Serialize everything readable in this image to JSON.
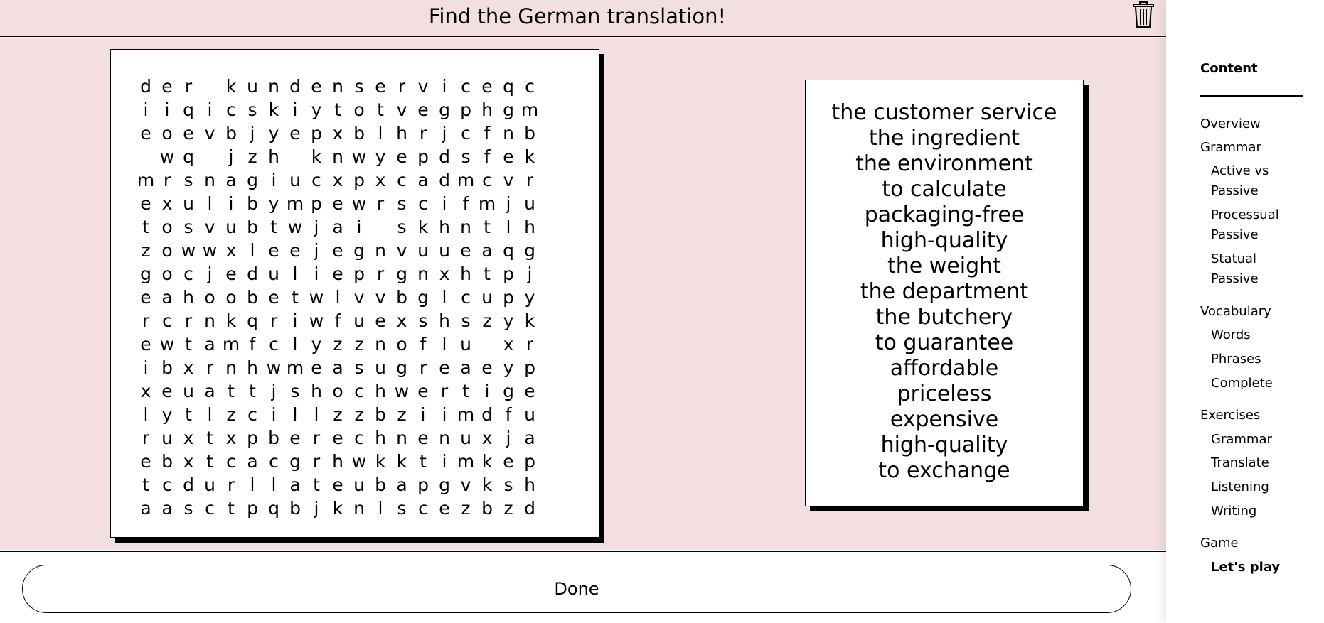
{
  "header": {
    "title": "Find the German translation!"
  },
  "grid": {
    "rows": [
      "der kundenserviceqc",
      "iiqicskiytotvegphgm",
      "eoevbjyepxblhrjcfnb",
      " wq jzh knwyepdsfek",
      "mrsnagiucxpxcadmcvr",
      "exulibympewrscifmju",
      "tosvubtwjai skhntlh",
      "zowwxleejegnvuueaqg",
      "gocjedulieprgnxhtpj",
      "eahoobetwlvvbglcupy",
      "rcrnkqriwfuexshszyk",
      "ewtamfclyzznoflu xr",
      "ibxrnhwmeasugreaeyp",
      "xeuattjshochwertige",
      "lytlzcillzzbziimdfu",
      "ruxtxpberechnenuxja",
      "ebxtcacgrhwkktimkep",
      "tcdurllateubapgvksh",
      "aasctpqbjknlscezbzd"
    ]
  },
  "words": [
    "the customer service",
    "the ingredient",
    "the environment",
    "to calculate",
    "packaging-free",
    "high-quality",
    "the weight",
    "the department",
    "the butchery",
    "to guarantee",
    "affordable",
    "priceless",
    "expensive",
    "high-quality",
    "to exchange"
  ],
  "footer": {
    "done_label": "Done"
  },
  "sidebar": {
    "title": "Content",
    "overview": "Overview",
    "grammar": "Grammar",
    "active_vs_passive_1": "Active vs",
    "active_vs_passive_2": "Passive",
    "processual_1": "Processual",
    "processual_2": "Passive",
    "statual_1": "Statual",
    "statual_2": "Passive",
    "vocabulary": "Vocabulary",
    "words": "Words",
    "phrases": "Phrases",
    "complete": "Complete",
    "exercises": "Exercises",
    "ex_grammar": "Grammar",
    "ex_translate": "Translate",
    "ex_listening": "Listening",
    "ex_writing": "Writing",
    "game": "Game",
    "lets_play": "Let's play"
  },
  "icons": {
    "trash": "trash-icon"
  },
  "colors": {
    "board_bg": "#f3dfe0",
    "ink": "#000000"
  }
}
